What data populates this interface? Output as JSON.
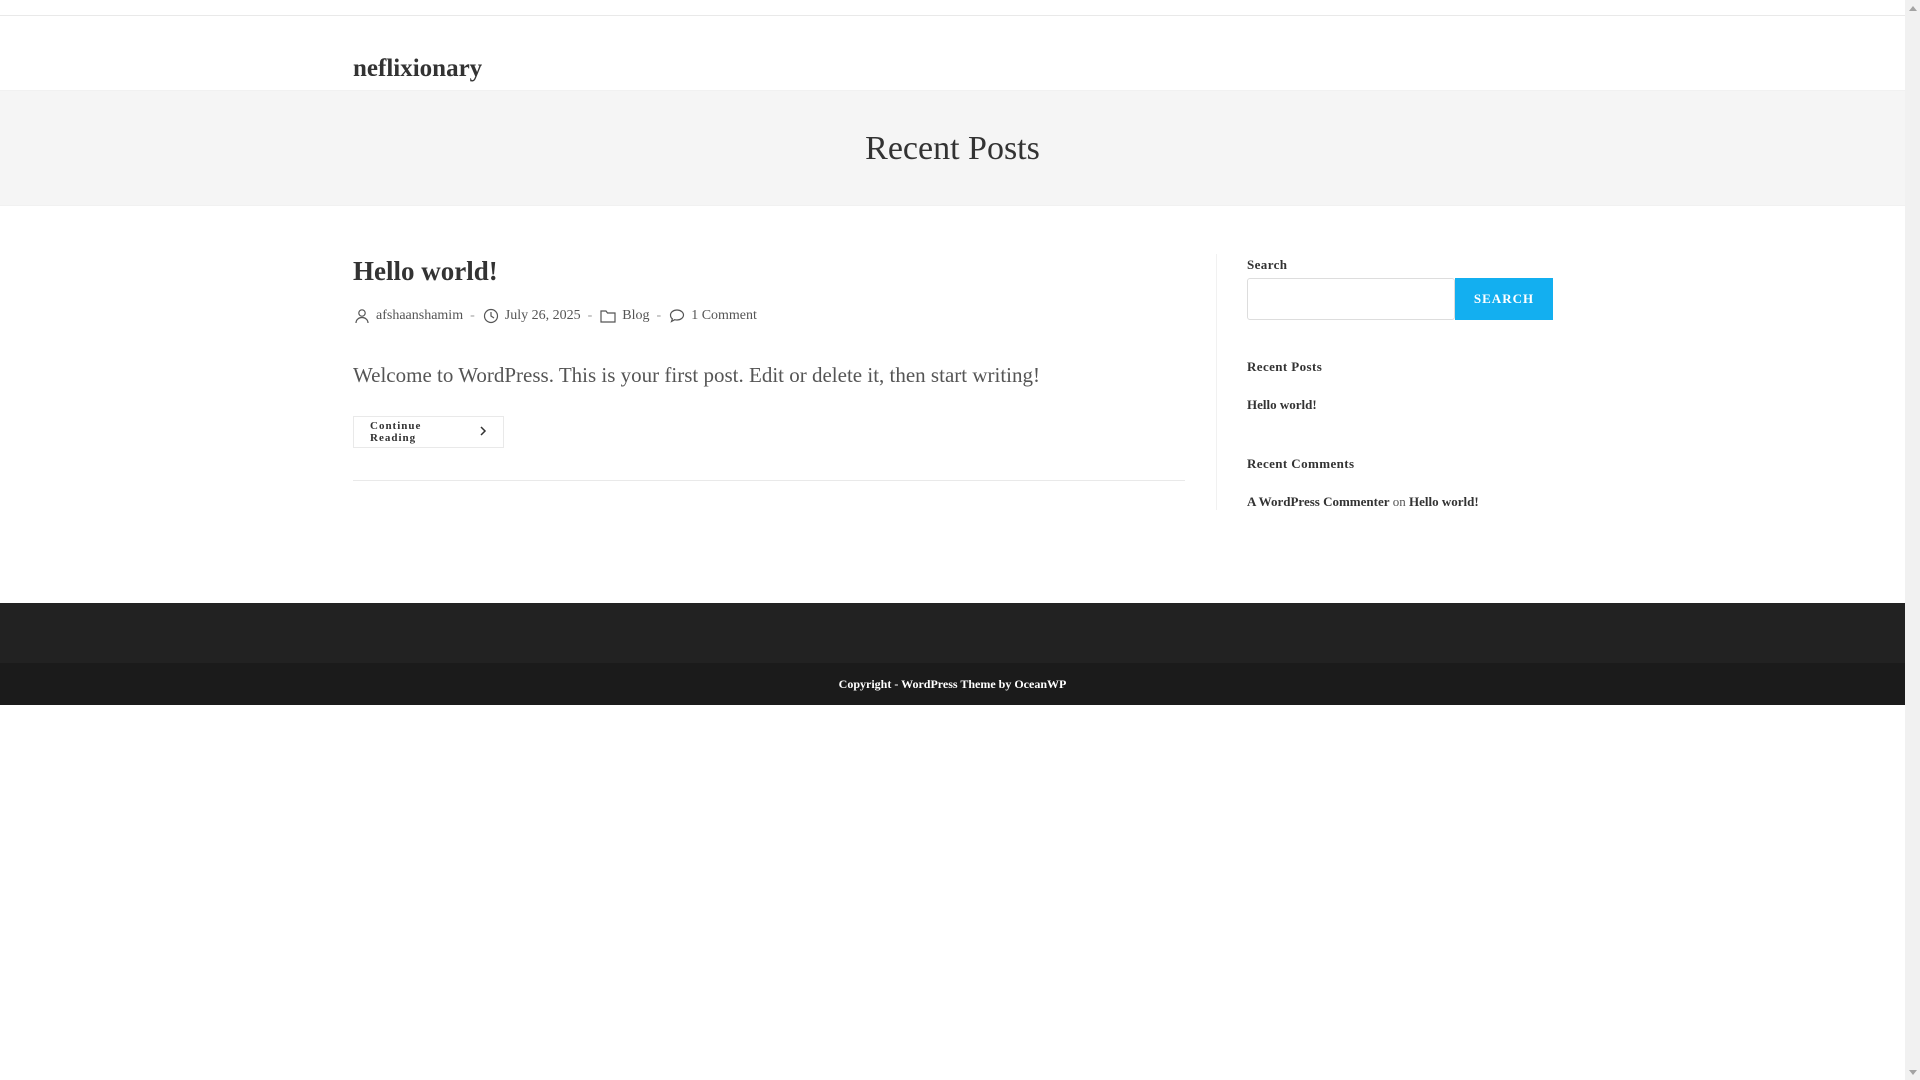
{
  "site": {
    "title": "neflixionary"
  },
  "page_header": {
    "title": "Recent Posts"
  },
  "post": {
    "title": "Hello world!",
    "author": "afshaanshamim",
    "date": "July 26, 2025",
    "category": "Blog",
    "comments": "1 Comment",
    "separator": "-",
    "excerpt": "Welcome to WordPress. This is your first post. Edit or delete it, then start writing!",
    "continue_label": "Continue Reading"
  },
  "sidebar": {
    "search_label": "Search",
    "search_placeholder": "",
    "search_button": "SEARCH",
    "recent_posts_title": "Recent Posts",
    "recent_posts": [
      "Hello world!"
    ],
    "recent_comments_title": "Recent Comments",
    "recent_comment": {
      "author": "A WordPress Commenter",
      "on": "on",
      "post": "Hello world!"
    }
  },
  "footer": {
    "copyright": "Copyright - WordPress Theme by OceanWP"
  },
  "colors": {
    "accent": "#13aff0",
    "footer_bg": "#222222",
    "footer_bottom_bg": "#1b1b1b",
    "page_header_bg": "#f5f5f5"
  },
  "icons": [
    "user-icon",
    "clock-icon",
    "folder-icon",
    "comment-icon",
    "chevron-right-icon"
  ]
}
